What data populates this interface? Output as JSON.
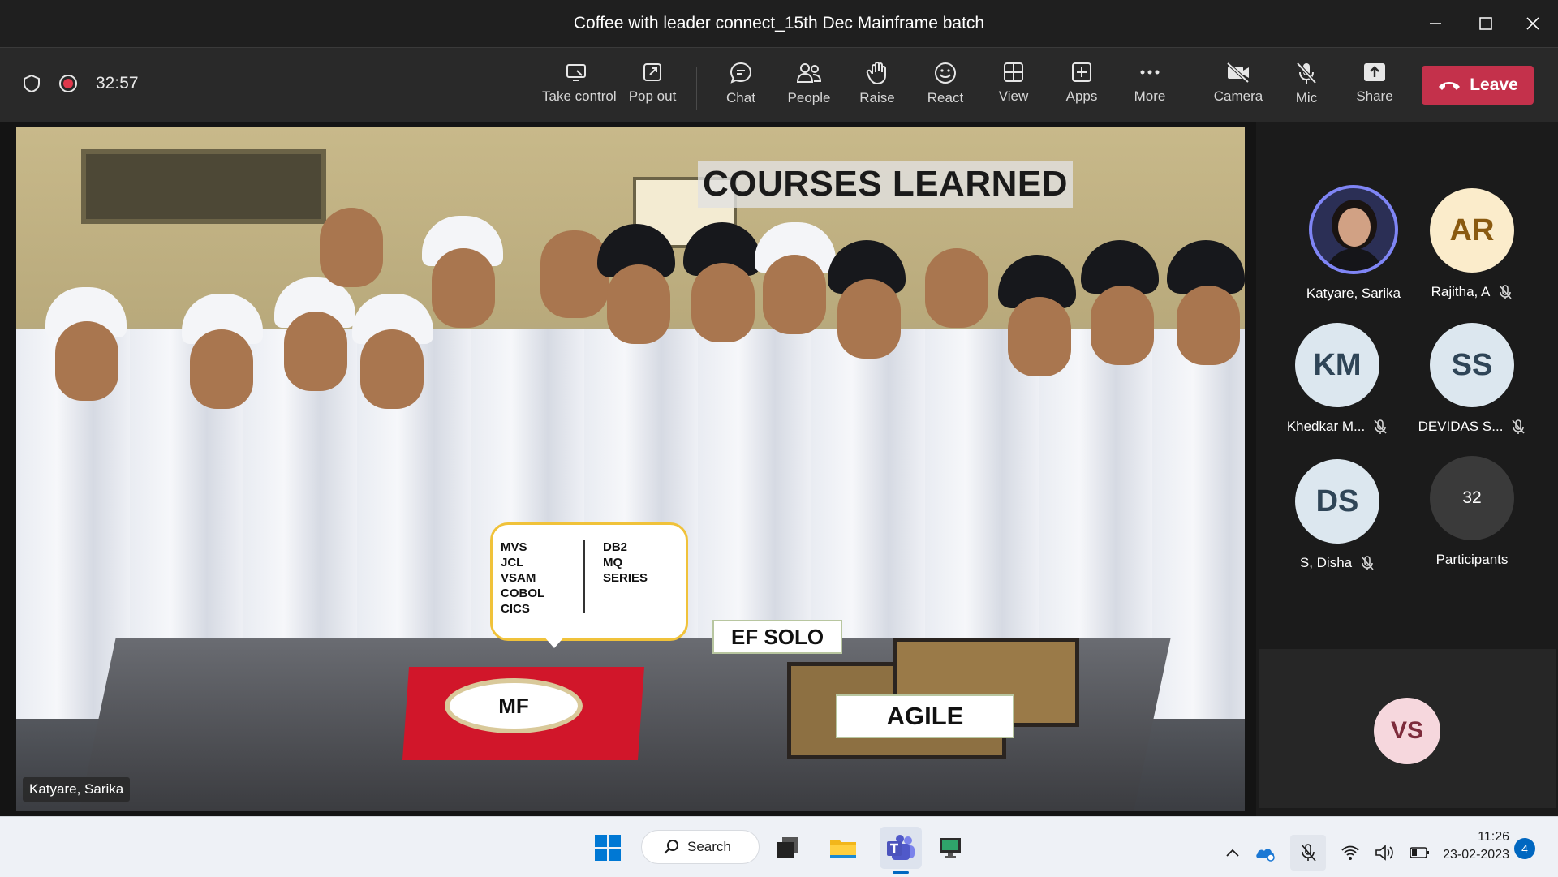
{
  "window": {
    "title": "Coffee with leader connect_15th Dec Mainframe batch"
  },
  "toolbar": {
    "timer": "32:57",
    "buttons": [
      {
        "label": "Take control",
        "icon": "take-control-icon"
      },
      {
        "label": "Pop out",
        "icon": "pop-out-icon"
      },
      {
        "label": "Chat",
        "icon": "chat-icon"
      },
      {
        "label": "People",
        "icon": "people-icon"
      },
      {
        "label": "Raise",
        "icon": "raise-hand-icon"
      },
      {
        "label": "React",
        "icon": "react-icon"
      },
      {
        "label": "View",
        "icon": "view-icon"
      },
      {
        "label": "Apps",
        "icon": "apps-icon"
      },
      {
        "label": "More",
        "icon": "more-icon"
      },
      {
        "label": "Camera",
        "icon": "camera-off-icon"
      },
      {
        "label": "Mic",
        "icon": "mic-off-icon"
      },
      {
        "label": "Share",
        "icon": "share-icon"
      }
    ],
    "leave_label": "Leave",
    "leave_color": "#c4314b"
  },
  "video": {
    "overlay_title": "COURSES LEARNED",
    "bubble_col1": [
      "MVS",
      "JCL",
      "VSAM",
      "COBOL",
      "CICS"
    ],
    "bubble_col2": [
      "DB2",
      "MQ",
      "SERIES"
    ],
    "plate_label": "MF",
    "ef_solo_label": "EF SOLO",
    "agile_label": "AGILE",
    "presenter_name": "Katyare, Sarika"
  },
  "participants": [
    {
      "name": "Katyare, Sarika",
      "initials": "",
      "muted": false,
      "avatar_bg": "#2b2f55",
      "is_photo": true
    },
    {
      "name": "Rajitha, A",
      "initials": "AR",
      "muted": true,
      "avatar_bg": "#fbeccb",
      "color": "#8a5a10"
    },
    {
      "name": "Khedkar M...",
      "initials": "KM",
      "muted": true,
      "avatar_bg": "#dce7ef",
      "color": "#2f4557"
    },
    {
      "name": "DEVIDAS S...",
      "initials": "SS",
      "muted": true,
      "avatar_bg": "#dce7ef",
      "color": "#2f4557"
    },
    {
      "name": "S, Disha",
      "initials": "DS",
      "muted": true,
      "avatar_bg": "#dce7ef",
      "color": "#2f4557"
    }
  ],
  "participants_more": {
    "count": "32",
    "label": "Participants"
  },
  "self_view": {
    "initials": "VS"
  },
  "taskbar": {
    "search_label": "Search",
    "time": "11:26",
    "date": "23-02-2023",
    "notification_count": "4"
  }
}
